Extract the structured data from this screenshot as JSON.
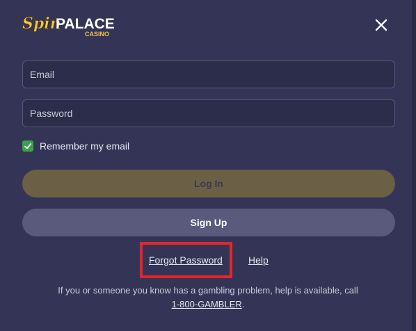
{
  "brand": {
    "logo_primary": "Spin",
    "logo_secondary": "PALACE",
    "logo_tagline": "CASINO",
    "logo_colors": {
      "gold": "#f5c242",
      "white": "#ffffff"
    }
  },
  "header": {
    "close_icon": "close-icon"
  },
  "form": {
    "email_placeholder": "Email",
    "password_placeholder": "Password",
    "remember_label": "Remember my email",
    "remember_checked": true,
    "login_label": "Log In",
    "signup_label": "Sign Up"
  },
  "links": {
    "forgot": "Forgot Password",
    "help": "Help"
  },
  "disclaimer": {
    "text": "If you or someone you know has a gambling problem, help is available, call",
    "phone": "1-800-GAMBLER",
    "suffix": "."
  },
  "colors": {
    "background": "#343556",
    "login_button": "#6b5f45",
    "signup_button": "#595a7c",
    "checkbox": "#3aa24a",
    "highlight": "#e3262c"
  }
}
